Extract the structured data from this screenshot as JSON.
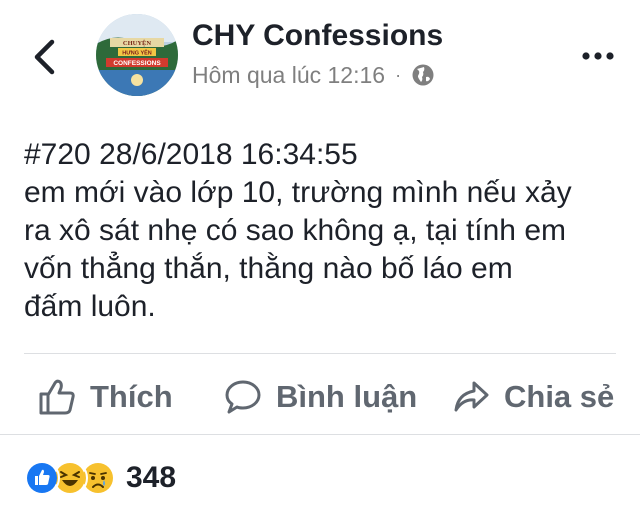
{
  "header": {
    "page_name": "CHY Confessions",
    "timestamp": "Hôm qua lúc 12:16",
    "separator": "·",
    "avatar_text": {
      "line1": "CHUYỆN",
      "line2": "HƯNG YÊN",
      "line3": "CONFESSIONS"
    }
  },
  "post": {
    "lines": [
      "#720 28/6/2018 16:34:55",
      "em mới vào lớp 10, trường mình nếu xảy",
      "ra xô sát nhẹ có sao không ạ, tại tính em",
      "vốn thẳng thắn, thằng nào bố láo em",
      "đấm luôn."
    ]
  },
  "actions": {
    "like": "Thích",
    "comment": "Bình luận",
    "share": "Chia sẻ"
  },
  "reactions": {
    "count": "348",
    "icons": [
      "like-icon",
      "haha-icon",
      "sad-icon"
    ]
  },
  "colors": {
    "text": "#1d2129",
    "meta": "#7f7f7f",
    "action": "#606770",
    "like_blue": "#1877f2",
    "emoji_yellow": "#f7c12e"
  }
}
